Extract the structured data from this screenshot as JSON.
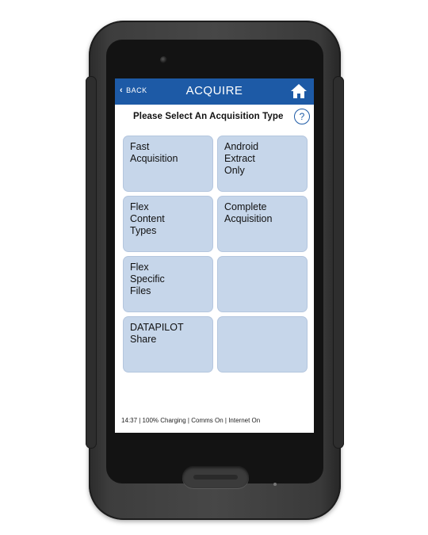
{
  "header": {
    "back_label": "BACK",
    "title": "ACQUIRE"
  },
  "subheader": {
    "prompt": "Please Select An Acquisition Type",
    "help_glyph": "?"
  },
  "tiles": [
    {
      "label": "Fast\nAcquisition"
    },
    {
      "label": "Android\nExtract\nOnly"
    },
    {
      "label": "Flex\nContent\nTypes"
    },
    {
      "label": "Complete\nAcquisition"
    },
    {
      "label": "Flex\nSpecific\nFiles"
    },
    {
      "label": ""
    },
    {
      "label": "DATAPILOT\nShare"
    },
    {
      "label": ""
    }
  ],
  "status_bar": {
    "text": "14:37  | 100%  Charging | Comms On | Internet On"
  },
  "colors": {
    "header_blue": "#1d5aa6",
    "tile_fill": "#c6d6ea"
  },
  "icons": {
    "back": "chevron-left-icon",
    "home": "home-icon",
    "help": "help-circle-icon"
  }
}
